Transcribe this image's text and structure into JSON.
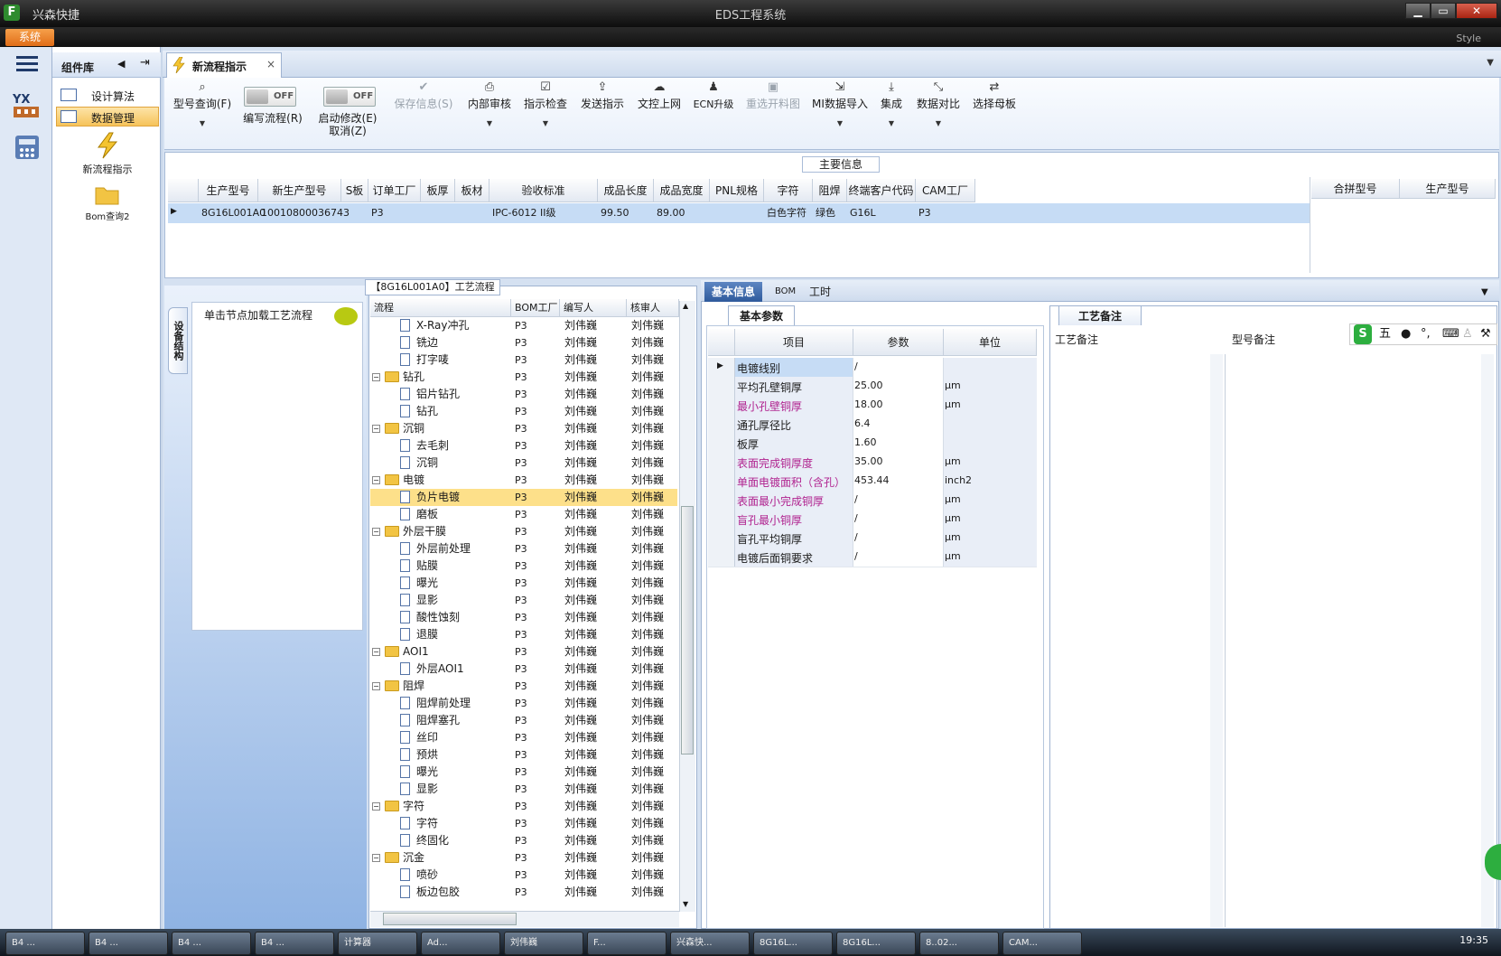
{
  "window": {
    "app_name": "兴森快捷",
    "title": "EDS工程系统",
    "logo": "F",
    "minimize": "▁",
    "restore": "▭",
    "close": "✕"
  },
  "menu": {
    "system": "系统",
    "style": "Style"
  },
  "sidebar": {
    "title": "组件库",
    "items": [
      {
        "label": "设计算法"
      },
      {
        "label": "数据管理"
      }
    ],
    "big_items": [
      {
        "label": "新流程指示"
      },
      {
        "label": "Bom查询2"
      }
    ]
  },
  "tab": {
    "label": "新流程指示",
    "close": "×"
  },
  "toolbar": {
    "buttons": [
      {
        "label": "型号查询(F)"
      },
      {
        "label": "编写流程(R)"
      },
      {
        "label": "启动修改(E)",
        "sub": "取消(Z)"
      },
      {
        "label": "保存信息(S)"
      },
      {
        "label": "内部审核"
      },
      {
        "label": "指示检查"
      },
      {
        "label": "发送指示"
      },
      {
        "label": "文控上网"
      },
      {
        "label": "ECN升级"
      },
      {
        "label": "重选开料图"
      },
      {
        "label": "MI数据导入"
      },
      {
        "label": "集成"
      },
      {
        "label": "数据对比"
      },
      {
        "label": "选择母板"
      }
    ],
    "toggle_off": "OFF"
  },
  "main_info": {
    "title": "主要信息",
    "columns": [
      "生产型号",
      "新生产型号",
      "S板",
      "订单工厂",
      "板厚",
      "板材",
      "验收标准",
      "成品长度",
      "成品宽度",
      "PNL规格",
      "字符",
      "阻焊",
      "终端客户代码",
      "CAM工厂"
    ],
    "row": [
      "8G16L001A0",
      "10010800036743",
      "",
      "P3",
      "",
      "",
      "IPC-6012 II级",
      "99.50",
      "89.00",
      "",
      "白色字符",
      "绿色",
      "G16L",
      "P3"
    ],
    "right_columns": [
      "合拼型号",
      "生产型号"
    ]
  },
  "process": {
    "load_tip": "单击节点加载工艺流程",
    "vtab": "设备结构",
    "title": "【8G16L001A0】工艺流程",
    "columns": [
      "流程",
      "BOM工厂",
      "编写人",
      "核审人"
    ],
    "rows": [
      {
        "name": "X-Ray冲孔",
        "level": 1,
        "folder": false,
        "factory": "P3",
        "writer": "刘伟巍",
        "reviewer": "刘伟巍"
      },
      {
        "name": "铣边",
        "level": 1,
        "folder": false,
        "factory": "P3",
        "writer": "刘伟巍",
        "reviewer": "刘伟巍"
      },
      {
        "name": "打字唛",
        "level": 1,
        "folder": false,
        "factory": "P3",
        "writer": "刘伟巍",
        "reviewer": "刘伟巍"
      },
      {
        "name": "钻孔",
        "level": 0,
        "folder": true,
        "factory": "P3",
        "writer": "刘伟巍",
        "reviewer": "刘伟巍"
      },
      {
        "name": "铝片钻孔",
        "level": 1,
        "folder": false,
        "factory": "P3",
        "writer": "刘伟巍",
        "reviewer": "刘伟巍"
      },
      {
        "name": "钻孔",
        "level": 1,
        "folder": false,
        "factory": "P3",
        "writer": "刘伟巍",
        "reviewer": "刘伟巍"
      },
      {
        "name": "沉铜",
        "level": 0,
        "folder": true,
        "factory": "P3",
        "writer": "刘伟巍",
        "reviewer": "刘伟巍"
      },
      {
        "name": "去毛刺",
        "level": 1,
        "folder": false,
        "factory": "P3",
        "writer": "刘伟巍",
        "reviewer": "刘伟巍"
      },
      {
        "name": "沉铜",
        "level": 1,
        "folder": false,
        "factory": "P3",
        "writer": "刘伟巍",
        "reviewer": "刘伟巍"
      },
      {
        "name": "电镀",
        "level": 0,
        "folder": true,
        "factory": "P3",
        "writer": "刘伟巍",
        "reviewer": "刘伟巍"
      },
      {
        "name": "负片电镀",
        "level": 1,
        "folder": false,
        "factory": "P3",
        "writer": "刘伟巍",
        "reviewer": "刘伟巍",
        "selected": true
      },
      {
        "name": "磨板",
        "level": 1,
        "folder": false,
        "factory": "P3",
        "writer": "刘伟巍",
        "reviewer": "刘伟巍"
      },
      {
        "name": "外层干膜",
        "level": 0,
        "folder": true,
        "factory": "P3",
        "writer": "刘伟巍",
        "reviewer": "刘伟巍"
      },
      {
        "name": "外层前处理",
        "level": 1,
        "folder": false,
        "factory": "P3",
        "writer": "刘伟巍",
        "reviewer": "刘伟巍"
      },
      {
        "name": "贴膜",
        "level": 1,
        "folder": false,
        "factory": "P3",
        "writer": "刘伟巍",
        "reviewer": "刘伟巍"
      },
      {
        "name": "曝光",
        "level": 1,
        "folder": false,
        "factory": "P3",
        "writer": "刘伟巍",
        "reviewer": "刘伟巍"
      },
      {
        "name": "显影",
        "level": 1,
        "folder": false,
        "factory": "P3",
        "writer": "刘伟巍",
        "reviewer": "刘伟巍"
      },
      {
        "name": "酸性蚀刻",
        "level": 1,
        "folder": false,
        "factory": "P3",
        "writer": "刘伟巍",
        "reviewer": "刘伟巍"
      },
      {
        "name": "退膜",
        "level": 1,
        "folder": false,
        "factory": "P3",
        "writer": "刘伟巍",
        "reviewer": "刘伟巍"
      },
      {
        "name": "AOI1",
        "level": 0,
        "folder": true,
        "factory": "P3",
        "writer": "刘伟巍",
        "reviewer": "刘伟巍"
      },
      {
        "name": "外层AOI1",
        "level": 1,
        "folder": false,
        "factory": "P3",
        "writer": "刘伟巍",
        "reviewer": "刘伟巍"
      },
      {
        "name": "阻焊",
        "level": 0,
        "folder": true,
        "factory": "P3",
        "writer": "刘伟巍",
        "reviewer": "刘伟巍"
      },
      {
        "name": "阻焊前处理",
        "level": 1,
        "folder": false,
        "factory": "P3",
        "writer": "刘伟巍",
        "reviewer": "刘伟巍"
      },
      {
        "name": "阻焊塞孔",
        "level": 1,
        "folder": false,
        "factory": "P3",
        "writer": "刘伟巍",
        "reviewer": "刘伟巍"
      },
      {
        "name": "丝印",
        "level": 1,
        "folder": false,
        "factory": "P3",
        "writer": "刘伟巍",
        "reviewer": "刘伟巍"
      },
      {
        "name": "预烘",
        "level": 1,
        "folder": false,
        "factory": "P3",
        "writer": "刘伟巍",
        "reviewer": "刘伟巍"
      },
      {
        "name": "曝光",
        "level": 1,
        "folder": false,
        "factory": "P3",
        "writer": "刘伟巍",
        "reviewer": "刘伟巍"
      },
      {
        "name": "显影",
        "level": 1,
        "folder": false,
        "factory": "P3",
        "writer": "刘伟巍",
        "reviewer": "刘伟巍"
      },
      {
        "name": "字符",
        "level": 0,
        "folder": true,
        "factory": "P3",
        "writer": "刘伟巍",
        "reviewer": "刘伟巍"
      },
      {
        "name": "字符",
        "level": 1,
        "folder": false,
        "factory": "P3",
        "writer": "刘伟巍",
        "reviewer": "刘伟巍"
      },
      {
        "name": "终固化",
        "level": 1,
        "folder": false,
        "factory": "P3",
        "writer": "刘伟巍",
        "reviewer": "刘伟巍"
      },
      {
        "name": "沉金",
        "level": 0,
        "folder": true,
        "factory": "P3",
        "writer": "刘伟巍",
        "reviewer": "刘伟巍"
      },
      {
        "name": "喷砂",
        "level": 1,
        "folder": false,
        "factory": "P3",
        "writer": "刘伟巍",
        "reviewer": "刘伟巍"
      },
      {
        "name": "板边包胶",
        "level": 1,
        "folder": false,
        "factory": "P3",
        "writer": "刘伟巍",
        "reviewer": "刘伟巍"
      }
    ]
  },
  "basic": {
    "tabs": [
      "基本信息",
      "BOM",
      "工时"
    ],
    "subtitle": "基本参数",
    "columns": [
      "项目",
      "参数",
      "单位"
    ],
    "rows": [
      {
        "name": "电镀线别",
        "value": "/",
        "unit": "",
        "magenta": false,
        "current": true
      },
      {
        "name": "平均孔壁铜厚",
        "value": "25.00",
        "unit": "μm",
        "magenta": false
      },
      {
        "name": "最小孔壁铜厚",
        "value": "18.00",
        "unit": "μm",
        "magenta": true
      },
      {
        "name": "通孔厚径比",
        "value": "6.4",
        "unit": "",
        "magenta": false
      },
      {
        "name": "板厚",
        "value": "1.60",
        "unit": "",
        "magenta": false
      },
      {
        "name": "表面完成铜厚度",
        "value": "35.00",
        "unit": "μm",
        "magenta": true
      },
      {
        "name": "单面电镀面积（含孔）",
        "value": "453.44",
        "unit": "inch2",
        "magenta": true
      },
      {
        "name": "表面最小完成铜厚",
        "value": "/",
        "unit": "μm",
        "magenta": true
      },
      {
        "name": "盲孔最小铜厚",
        "value": "/",
        "unit": "μm",
        "magenta": true
      },
      {
        "name": "盲孔平均铜厚",
        "value": "/",
        "unit": "μm",
        "magenta": false
      },
      {
        "name": "电镀后面铜要求",
        "value": "/",
        "unit": "μm",
        "magenta": false
      }
    ]
  },
  "remarks": {
    "title": "工艺备注",
    "col1": "工艺备注",
    "col2": "型号备注",
    "ime": "五"
  },
  "taskbar": {
    "time": "19:35",
    "items": [
      "B4 ...",
      "B4 ...",
      "B4 ...",
      "B4 ...",
      "计算器",
      "Ad...",
      "刘伟巍",
      "F...",
      "兴森快...",
      "8G16L...",
      "8G16L...",
      "8..02...",
      "CAM..."
    ]
  },
  "colors": {
    "accent": "#2f5a9c",
    "selected_row": "#fde08a",
    "magenta": "#b0228f",
    "system_btn": "#e06d18"
  }
}
